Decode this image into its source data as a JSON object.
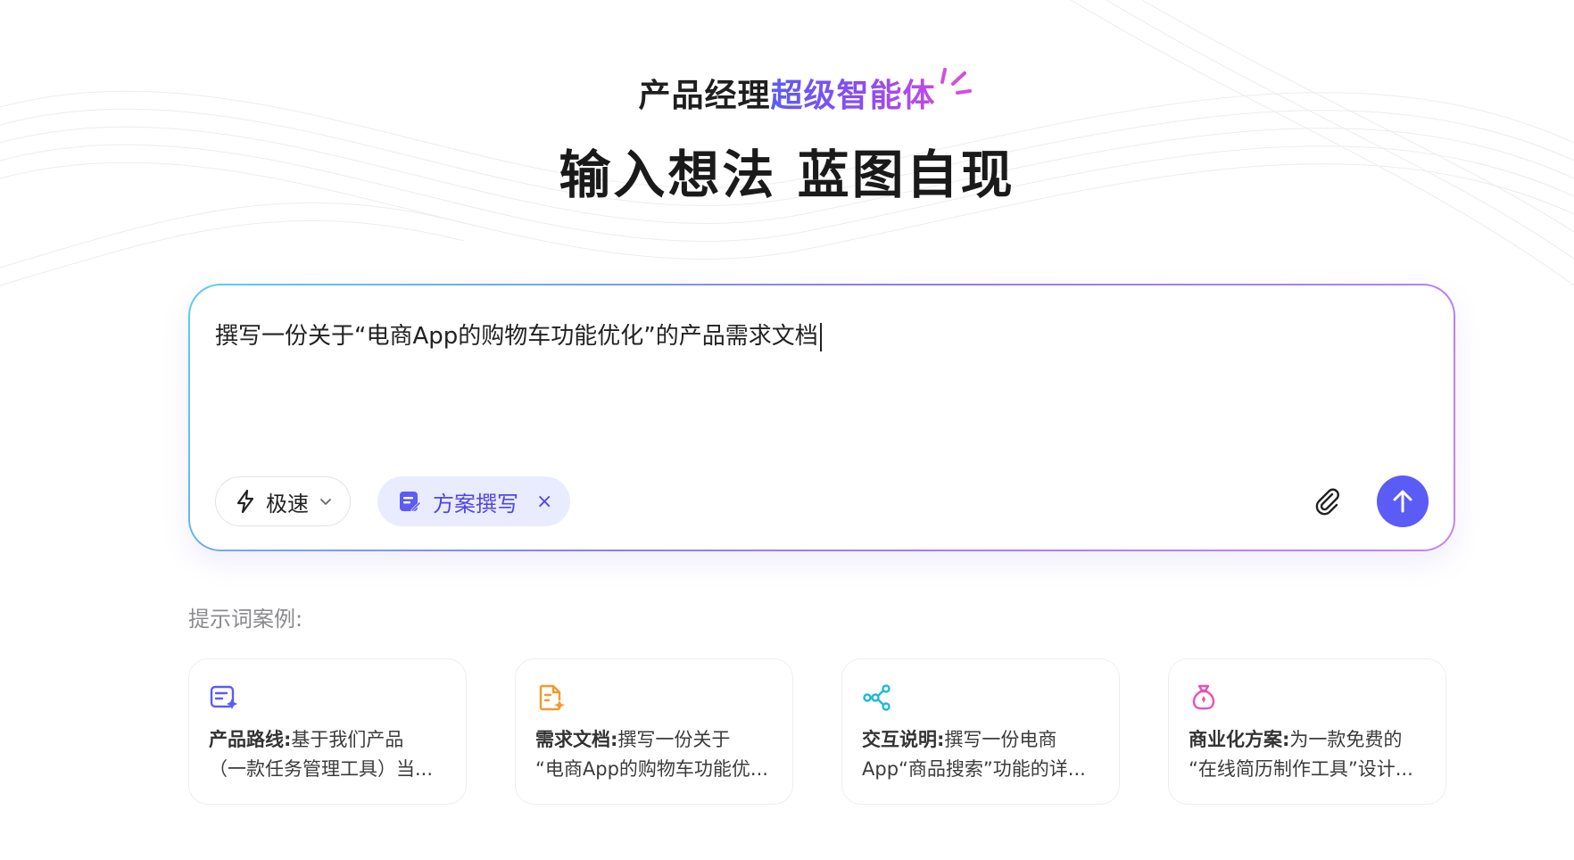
{
  "hero": {
    "subtitle_plain": "产品经理",
    "subtitle_accent": "超级智能体",
    "headline": "输入想法 蓝图自现"
  },
  "composer": {
    "prompt_text": "撰写一份关于“电商App的购物车功能优化”的产品需求文档",
    "mode_label": "极速",
    "skill_label": "方案撰写",
    "close_symbol": "×"
  },
  "examples": {
    "label": "提示词案例:",
    "cards": [
      {
        "title": "产品路线:",
        "line1": "基于我们产品",
        "line2": "（一款任务管理工具）当...",
        "icon": "doc-sparkle-icon",
        "color": "#5b5cf6"
      },
      {
        "title": "需求文档:",
        "line1": "撰写一份关于",
        "line2": "“电商App的购物车功能优...",
        "icon": "file-edit-icon",
        "color": "#f39a2b"
      },
      {
        "title": "交互说明:",
        "line1": "撰写一份电商",
        "line2": "App“商品搜索”功能的详...",
        "icon": "flow-nodes-icon",
        "color": "#21b8d6"
      },
      {
        "title": "商业化方案:",
        "line1": "为一款免费的",
        "line2": "“在线简历制作工具”设计...",
        "icon": "money-bag-icon",
        "color": "#e84fb8"
      }
    ]
  },
  "colors": {
    "accent": "#5b5cf6",
    "chip_bg": "#e9ecff"
  }
}
